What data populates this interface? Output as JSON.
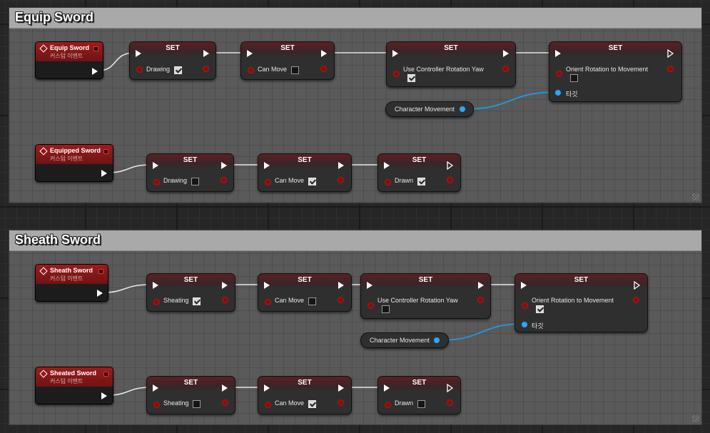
{
  "comments": {
    "equip": {
      "title": "Equip Sword"
    },
    "sheath": {
      "title": "Sheath Sword"
    }
  },
  "events": {
    "equip_sword": {
      "title": "Equip Sword",
      "subtitle": "커스텀 이벤트"
    },
    "equipped_sword": {
      "title": "Equipped Sword",
      "subtitle": "커스텀 이벤트"
    },
    "sheath_sword": {
      "title": "Sheath Sword",
      "subtitle": "커스텀 이벤트"
    },
    "sheated_sword": {
      "title": "Sheated Sword",
      "subtitle": "커스텀 이벤트"
    }
  },
  "set_nodes": [
    {
      "title": "SET",
      "label": "Drawing",
      "checked": true
    },
    {
      "title": "SET",
      "label": "Can Move",
      "checked": false
    },
    {
      "title": "SET",
      "label": "Use Controller Rotation Yaw",
      "checked": true
    },
    {
      "title": "SET",
      "label": "Orient Rotation to Movement",
      "checked": false,
      "target_label": "타깃"
    },
    {
      "title": "SET",
      "label": "Drawing",
      "checked": false
    },
    {
      "title": "SET",
      "label": "Can Move",
      "checked": true
    },
    {
      "title": "SET",
      "label": "Drawn",
      "checked": true
    },
    {
      "title": "SET",
      "label": "Sheating",
      "checked": true
    },
    {
      "title": "SET",
      "label": "Can Move",
      "checked": false
    },
    {
      "title": "SET",
      "label": "Use Controller Rotation Yaw",
      "checked": false
    },
    {
      "title": "SET",
      "label": "Orient Rotation to Movement",
      "checked": true,
      "target_label": "타깃"
    },
    {
      "title": "SET",
      "label": "Sheating",
      "checked": false
    },
    {
      "title": "SET",
      "label": "Can Move",
      "checked": true
    },
    {
      "title": "SET",
      "label": "Drawn",
      "checked": false
    }
  ],
  "getters": [
    {
      "label": "Character Movement"
    },
    {
      "label": "Character Movement"
    }
  ],
  "colors": {
    "exec_wire": "#e6e6e6",
    "object_wire": "#1e9be0",
    "bool_pin": "#8a0d0d",
    "event_header": "#9b1c1c"
  }
}
